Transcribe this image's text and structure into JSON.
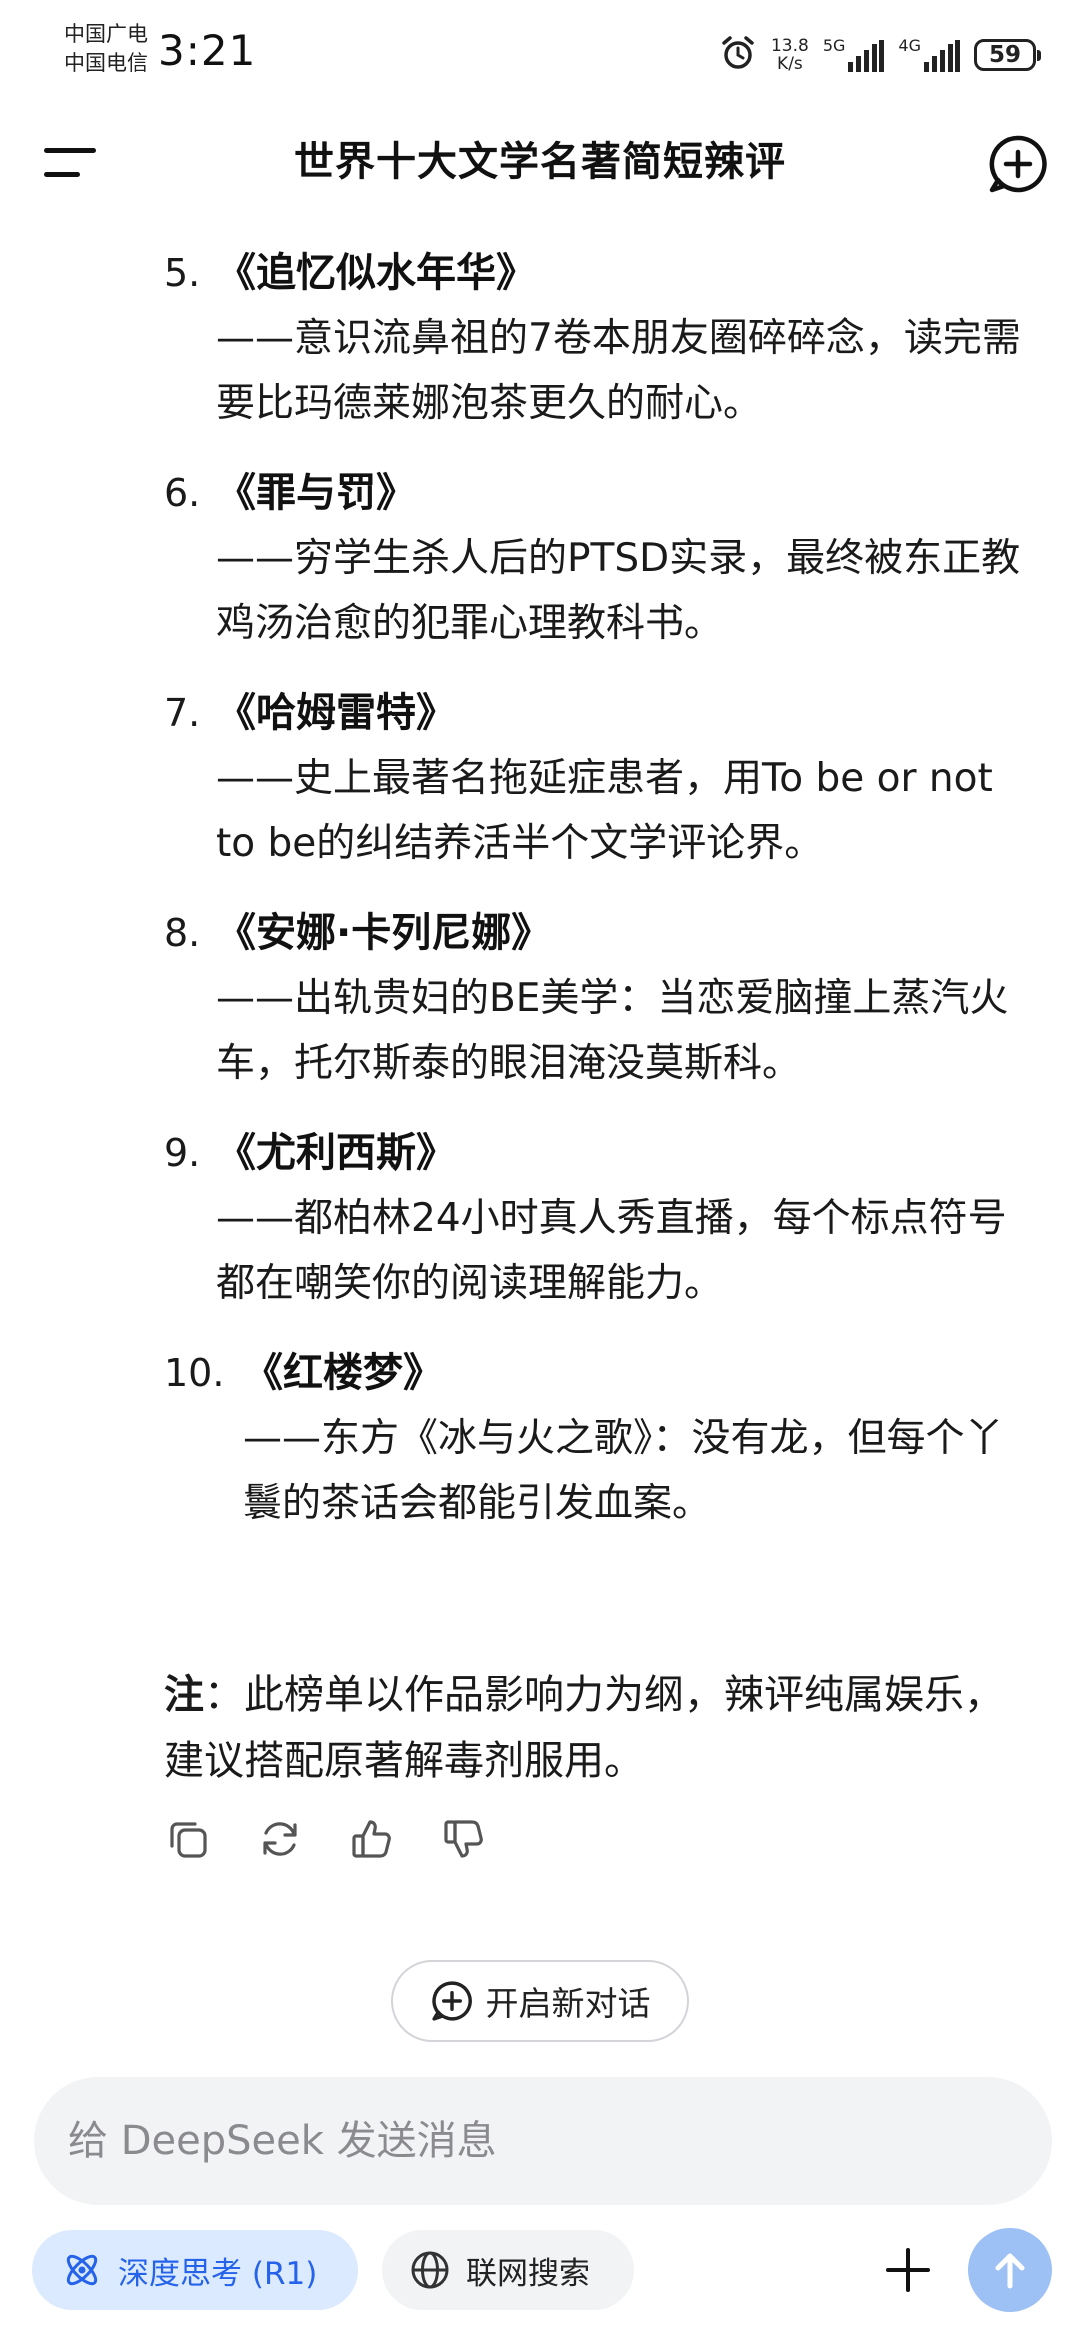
{
  "status_bar": {
    "carrier_1": "中国广电",
    "carrier_2": "中国电信",
    "time": "3:21",
    "speed_value": "13.8",
    "speed_unit": "K/s",
    "net_1": "5G",
    "net_2": "4G",
    "battery": "59"
  },
  "header": {
    "title": "世界十大文学名著简短辣评"
  },
  "items": [
    {
      "num": "5.",
      "title": "《追忆似水年华》",
      "desc": "——意识流鼻祖的7卷本朋友圈碎碎念，读完需要比玛德莱娜泡茶更久的耐心。"
    },
    {
      "num": "6.",
      "title": "《罪与罚》",
      "desc": "——穷学生杀人后的PTSD实录，最终被东正教鸡汤治愈的犯罪心理教科书。"
    },
    {
      "num": "7.",
      "title": "《哈姆雷特》",
      "desc": "——史上最著名拖延症患者，用To be or not to be的纠结养活半个文学评论界。"
    },
    {
      "num": "8.",
      "title": "《安娜·卡列尼娜》",
      "desc": "——出轨贵妇的BE美学：当恋爱脑撞上蒸汽火车，托尔斯泰的眼泪淹没莫斯科。"
    },
    {
      "num": "9.",
      "title": "《尤利西斯》",
      "desc": "——都柏林24小时真人秀直播，每个标点符号都在嘲笑你的阅读理解能力。"
    },
    {
      "num": "10.",
      "title": "《红楼梦》",
      "desc": "——东方《冰与火之歌》：没有龙，但每个丫鬟的茶话会都能引发血案。"
    }
  ],
  "note": {
    "label": "注",
    "text": "：此榜单以作品影响力为纲，辣评纯属娱乐，建议搭配原著解毒剂服用。"
  },
  "new_chat": {
    "label": "开启新对话"
  },
  "input": {
    "placeholder": "给 DeepSeek 发送消息"
  },
  "toolbar": {
    "deep_think_label": "深度思考 (R1)",
    "web_search_label": "联网搜索"
  },
  "colors": {
    "accent": "#2563eb",
    "accent_bg": "#dbeafe",
    "send_button": "#9dc0f5",
    "input_bg": "#f2f3f5"
  }
}
